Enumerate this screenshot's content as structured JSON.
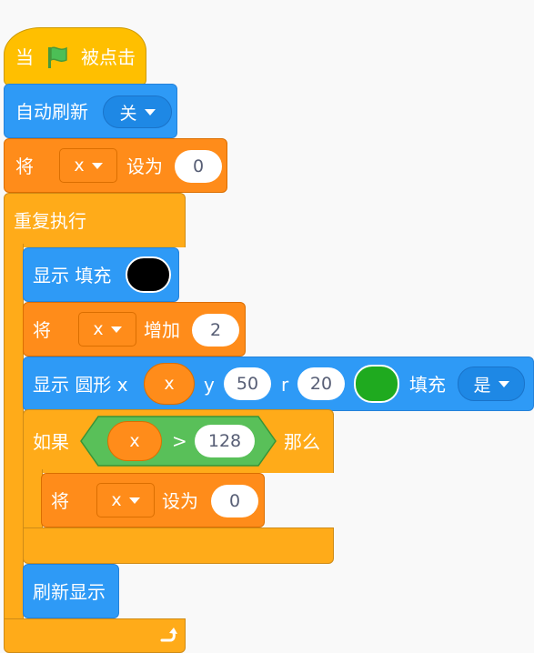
{
  "hat": {
    "prefix": "当",
    "suffix": "被点击"
  },
  "auto_refresh": {
    "label": "自动刷新",
    "value": "关"
  },
  "set_var_1": {
    "label": "将",
    "var": "x",
    "mid": "设为",
    "value": "0"
  },
  "repeat": {
    "label": "重复执行"
  },
  "show_fill": {
    "label": "显示 填充",
    "color": "#000000"
  },
  "change_var": {
    "label": "将",
    "var": "x",
    "mid": "增加",
    "value": "2"
  },
  "circle": {
    "label": "显示 圆形 x",
    "x_var": "x",
    "y_label": "y",
    "y_value": "50",
    "r_label": "r",
    "r_value": "20",
    "color": "#1FAA1F",
    "fill_label": "填充",
    "fill_value": "是"
  },
  "if_block": {
    "label": "如果",
    "left_var": "x",
    "op": ">",
    "right_value": "128",
    "then": "那么"
  },
  "set_var_2": {
    "label": "将",
    "var": "x",
    "mid": "设为",
    "value": "0"
  },
  "refresh": {
    "label": "刷新显示"
  },
  "colors": {
    "events": "#FFBF00",
    "pen": "#2E9AF6",
    "variables": "#FF8C1A",
    "control": "#FFAB19",
    "operators": "#59C059"
  }
}
